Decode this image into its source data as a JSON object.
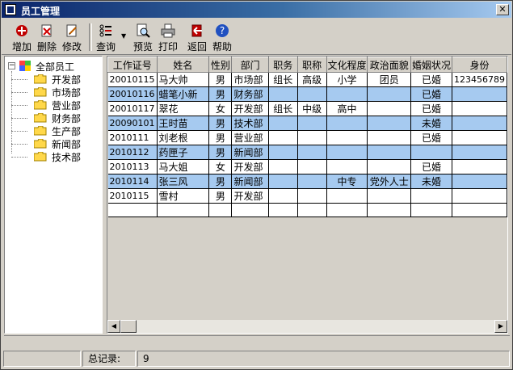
{
  "window": {
    "title": "员工管理"
  },
  "toolbar": {
    "add_label": "增加",
    "delete_label": "删除",
    "edit_label": "修改",
    "query_label": "查询",
    "preview_label": "预览",
    "print_label": "打印",
    "back_label": "返回",
    "help_label": "帮助"
  },
  "tree": {
    "root_label": "全部员工",
    "departments": [
      "开发部",
      "市场部",
      "营业部",
      "财务部",
      "生产部",
      "新闻部",
      "技术部"
    ]
  },
  "table": {
    "columns": [
      "工作证号",
      "姓名",
      "性别",
      "部门",
      "职务",
      "职称",
      "文化程度",
      "政治面貌",
      "婚姻状况",
      "身份"
    ],
    "rows": [
      [
        "20010115",
        "马大帅",
        "男",
        "市场部",
        "组长",
        "高级",
        "小学",
        "团员",
        "已婚",
        "123456789"
      ],
      [
        "20010116",
        "蜡笔小新",
        "男",
        "财务部",
        "",
        "",
        "",
        "",
        "已婚",
        ""
      ],
      [
        "20010117",
        "翠花",
        "女",
        "开发部",
        "组长",
        "中级",
        "高中",
        "",
        "已婚",
        ""
      ],
      [
        "20090101",
        "王时苗",
        "男",
        "技术部",
        "",
        "",
        "",
        "",
        "未婚",
        ""
      ],
      [
        "2010111",
        "刘老根",
        "男",
        "营业部",
        "",
        "",
        "",
        "",
        "已婚",
        ""
      ],
      [
        "2010112",
        "药匣子",
        "男",
        "新闻部",
        "",
        "",
        "",
        "",
        "",
        ""
      ],
      [
        "2010113",
        "马大姐",
        "女",
        "开发部",
        "",
        "",
        "",
        "",
        "已婚",
        ""
      ],
      [
        "2010114",
        "张三风",
        "男",
        "新闻部",
        "",
        "",
        "中专",
        "党外人士",
        "未婚",
        ""
      ],
      [
        "2010115",
        "雪村",
        "男",
        "开发部",
        "",
        "",
        "",
        "",
        "",
        ""
      ]
    ]
  },
  "status": {
    "total_label": "总记录:",
    "total_value": "9"
  },
  "colors": {
    "selected_row": "#a6caf0",
    "title_bar": "#0a246a"
  }
}
